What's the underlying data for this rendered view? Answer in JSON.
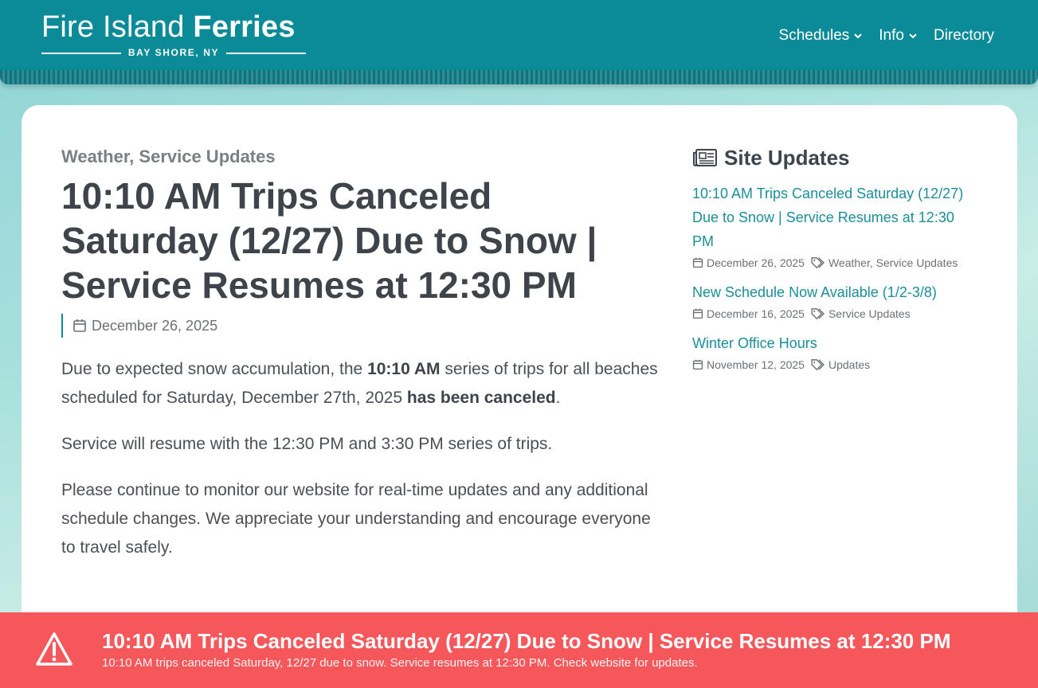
{
  "header": {
    "logo": {
      "title_light": "Fire Island",
      "title_bold": "Ferries",
      "location": "BAY SHORE, NY"
    },
    "nav": [
      {
        "label": "Schedules",
        "has_dropdown": true
      },
      {
        "label": "Info",
        "has_dropdown": true
      },
      {
        "label": "Directory",
        "has_dropdown": false
      }
    ]
  },
  "article": {
    "category": "Weather, Service Updates",
    "title": "10:10 AM Trips Canceled Saturday (12/27) Due to Snow | Service Resumes at 12:30 PM",
    "date": "December 26, 2025",
    "p1_a": "Due to expected snow accumulation, the ",
    "p1_b": "10:10 AM",
    "p1_c": " series of trips for all beaches scheduled for Saturday, December 27th, 2025 ",
    "p1_d": "has been canceled",
    "p1_e": ".",
    "p2": "Service will resume with the 12:30 PM and 3:30 PM series of trips.",
    "p3": "Please continue to monitor our website for real-time updates and any additional schedule changes. We appreciate your understanding and encourage everyone to travel safely."
  },
  "sidebar": {
    "heading": "Site Updates",
    "items": [
      {
        "title": "10:10 AM Trips Canceled Saturday (12/27) Due to Snow | Service Resumes at 12:30 PM",
        "date": "December 26, 2025",
        "tags": "Weather, Service Updates"
      },
      {
        "title": "New Schedule Now Available (1/2-3/8)",
        "date": "December 16, 2025",
        "tags": "Service Updates"
      },
      {
        "title": "Winter Office Hours",
        "date": "November 12, 2025",
        "tags": "Updates"
      }
    ]
  },
  "alert": {
    "title": "10:10 AM Trips Canceled Saturday (12/27) Due to Snow | Service Resumes at 12:30 PM",
    "subtitle": "10:10 AM trips canceled Saturday, 12/27 due to snow. Service resumes at 12:30 PM. Check website for updates.",
    "icon": "warning-icon"
  },
  "colors": {
    "brand_teal": "#0b8a98",
    "link": "#1a8e99",
    "alert_red": "#f5575b"
  }
}
